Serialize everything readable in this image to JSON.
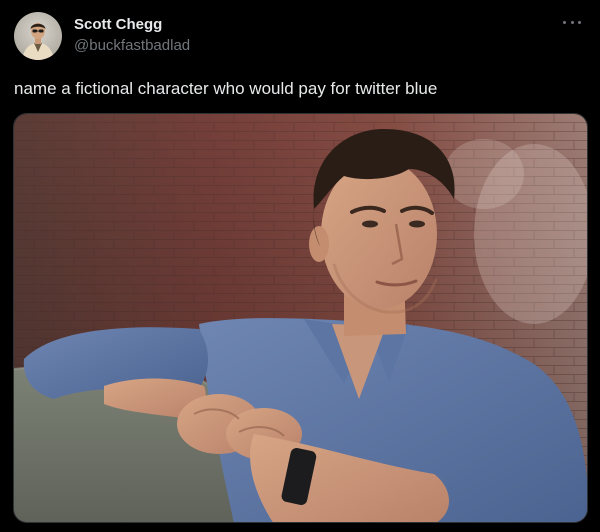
{
  "tweet": {
    "author": {
      "display_name": "Scott Chegg",
      "handle": "@buckfastbadlad",
      "avatar_icon": "user-avatar"
    },
    "menu_icon": "more-options-icon",
    "text": "name a fictional character who would pay for twitter blue",
    "media": {
      "kind": "photo",
      "description_icon": "photo-man-leaning-on-ledge"
    }
  },
  "colors": {
    "background": "#000000",
    "primary_text": "#e7e9ea",
    "secondary_text": "#71767b",
    "border": "#2f3336"
  }
}
